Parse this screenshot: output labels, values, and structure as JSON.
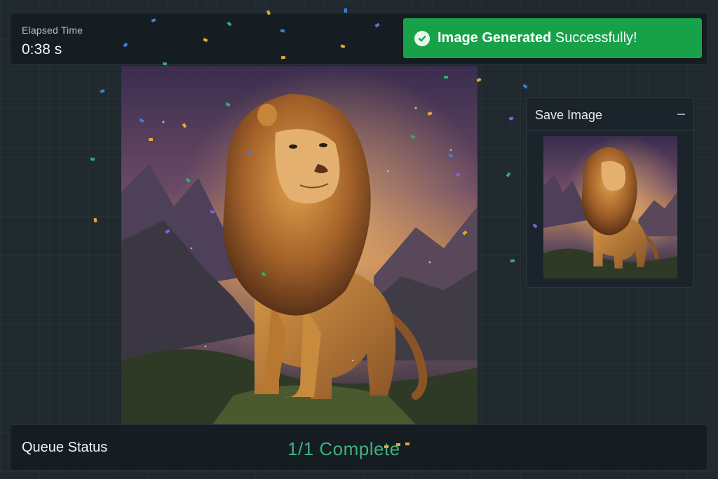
{
  "elapsed": {
    "label": "Elapsed Time",
    "value": "0:38 s"
  },
  "banner": {
    "bold_text": "Image Generated",
    "text": " Successfully!",
    "icon": "check-circle-icon",
    "color": "#17a24a"
  },
  "main_image": {
    "subject": "lion-illustration"
  },
  "save_panel": {
    "title": "Save Image",
    "collapse_icon": "minus-icon",
    "thumbnail": "lion-illustration-thumbnail"
  },
  "queue": {
    "label": "Queue Status",
    "status": "1/1 Complete",
    "status_color": "#3fb27f"
  },
  "confetti_colors": [
    "#3d7fd8",
    "#e2a93a",
    "#2fae6f",
    "#8a5cd6"
  ]
}
